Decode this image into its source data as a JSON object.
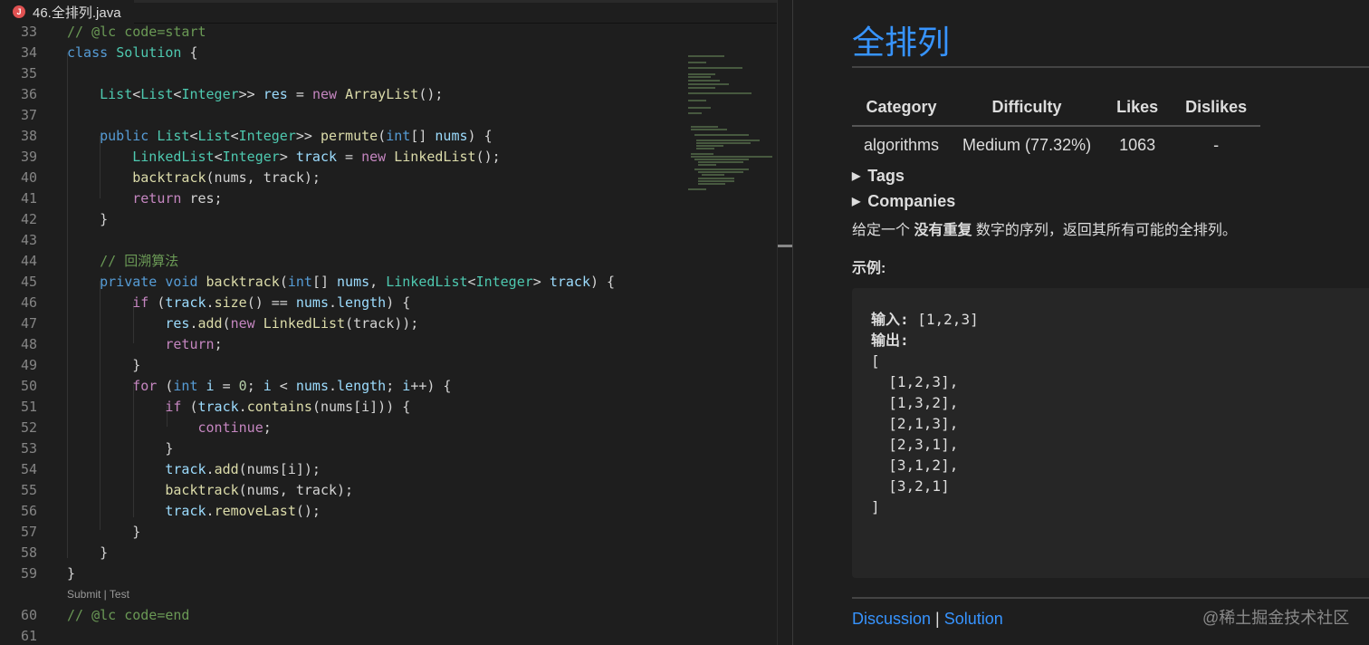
{
  "tab": {
    "icon": "J",
    "filename": "46.全排列.java"
  },
  "editor": {
    "lines": [
      {
        "n": "33",
        "t": [
          [
            "// @lc code=start",
            "cm"
          ]
        ]
      },
      {
        "n": "34",
        "t": [
          [
            "class ",
            "k"
          ],
          [
            "Solution",
            "t"
          ],
          [
            " {",
            "p"
          ]
        ]
      },
      {
        "n": "35",
        "t": []
      },
      {
        "n": "36",
        "t": [
          [
            "    ",
            "p"
          ],
          [
            "List",
            "t"
          ],
          [
            "<",
            "p"
          ],
          [
            "List",
            "t"
          ],
          [
            "<",
            "p"
          ],
          [
            "Integer",
            "t"
          ],
          [
            ">> ",
            "p"
          ],
          [
            "res",
            "v"
          ],
          [
            " = ",
            "p"
          ],
          [
            "new ",
            "c"
          ],
          [
            "ArrayList",
            "f"
          ],
          [
            "();",
            "p"
          ]
        ]
      },
      {
        "n": "37",
        "t": []
      },
      {
        "n": "38",
        "t": [
          [
            "    ",
            "p"
          ],
          [
            "public ",
            "k"
          ],
          [
            "List",
            "t"
          ],
          [
            "<",
            "p"
          ],
          [
            "List",
            "t"
          ],
          [
            "<",
            "p"
          ],
          [
            "Integer",
            "t"
          ],
          [
            ">> ",
            "p"
          ],
          [
            "permute",
            "f"
          ],
          [
            "(",
            "p"
          ],
          [
            "int",
            "k"
          ],
          [
            "[] ",
            "p"
          ],
          [
            "nums",
            "v"
          ],
          [
            ") {",
            "p"
          ]
        ]
      },
      {
        "n": "39",
        "t": [
          [
            "        ",
            "p"
          ],
          [
            "LinkedList",
            "t"
          ],
          [
            "<",
            "p"
          ],
          [
            "Integer",
            "t"
          ],
          [
            "> ",
            "p"
          ],
          [
            "track",
            "v"
          ],
          [
            " = ",
            "p"
          ],
          [
            "new ",
            "c"
          ],
          [
            "LinkedList",
            "f"
          ],
          [
            "();",
            "p"
          ]
        ]
      },
      {
        "n": "40",
        "t": [
          [
            "        ",
            "p"
          ],
          [
            "backtrack",
            "f"
          ],
          [
            "(nums, track);",
            "p"
          ]
        ]
      },
      {
        "n": "41",
        "t": [
          [
            "        ",
            "p"
          ],
          [
            "return ",
            "c"
          ],
          [
            "res;",
            "p"
          ]
        ]
      },
      {
        "n": "42",
        "t": [
          [
            "    }",
            "p"
          ]
        ]
      },
      {
        "n": "43",
        "t": []
      },
      {
        "n": "44",
        "t": [
          [
            "    ",
            "p"
          ],
          [
            "// 回溯算法",
            "cm"
          ]
        ]
      },
      {
        "n": "45",
        "t": [
          [
            "    ",
            "p"
          ],
          [
            "private ",
            "k"
          ],
          [
            "void ",
            "k"
          ],
          [
            "backtrack",
            "f"
          ],
          [
            "(",
            "p"
          ],
          [
            "int",
            "k"
          ],
          [
            "[] ",
            "p"
          ],
          [
            "nums",
            "v"
          ],
          [
            ", ",
            "p"
          ],
          [
            "LinkedList",
            "t"
          ],
          [
            "<",
            "p"
          ],
          [
            "Integer",
            "t"
          ],
          [
            "> ",
            "p"
          ],
          [
            "track",
            "v"
          ],
          [
            ") {",
            "p"
          ]
        ]
      },
      {
        "n": "46",
        "t": [
          [
            "        ",
            "p"
          ],
          [
            "if ",
            "c"
          ],
          [
            "(",
            "p"
          ],
          [
            "track",
            "v"
          ],
          [
            ".",
            "p"
          ],
          [
            "size",
            "f"
          ],
          [
            "() == ",
            "p"
          ],
          [
            "nums",
            "v"
          ],
          [
            ".",
            "p"
          ],
          [
            "length",
            "v"
          ],
          [
            ") {",
            "p"
          ]
        ]
      },
      {
        "n": "47",
        "t": [
          [
            "            ",
            "p"
          ],
          [
            "res",
            "v"
          ],
          [
            ".",
            "p"
          ],
          [
            "add",
            "f"
          ],
          [
            "(",
            "p"
          ],
          [
            "new ",
            "c"
          ],
          [
            "LinkedList",
            "f"
          ],
          [
            "(track));",
            "p"
          ]
        ]
      },
      {
        "n": "48",
        "t": [
          [
            "            ",
            "p"
          ],
          [
            "return",
            "c"
          ],
          [
            ";",
            "p"
          ]
        ]
      },
      {
        "n": "49",
        "t": [
          [
            "        }",
            "p"
          ]
        ]
      },
      {
        "n": "50",
        "t": [
          [
            "        ",
            "p"
          ],
          [
            "for ",
            "c"
          ],
          [
            "(",
            "p"
          ],
          [
            "int ",
            "k"
          ],
          [
            "i",
            "v"
          ],
          [
            " = ",
            "p"
          ],
          [
            "0",
            "n"
          ],
          [
            "; ",
            "p"
          ],
          [
            "i",
            "v"
          ],
          [
            " < ",
            "p"
          ],
          [
            "nums",
            "v"
          ],
          [
            ".",
            "p"
          ],
          [
            "length",
            "v"
          ],
          [
            "; ",
            "p"
          ],
          [
            "i",
            "v"
          ],
          [
            "++) {",
            "p"
          ]
        ]
      },
      {
        "n": "51",
        "t": [
          [
            "            ",
            "p"
          ],
          [
            "if ",
            "c"
          ],
          [
            "(",
            "p"
          ],
          [
            "track",
            "v"
          ],
          [
            ".",
            "p"
          ],
          [
            "contains",
            "f"
          ],
          [
            "(nums[i])) {",
            "p"
          ]
        ]
      },
      {
        "n": "52",
        "t": [
          [
            "                ",
            "p"
          ],
          [
            "continue",
            "c"
          ],
          [
            ";",
            "p"
          ]
        ]
      },
      {
        "n": "53",
        "t": [
          [
            "            }",
            "p"
          ]
        ]
      },
      {
        "n": "54",
        "t": [
          [
            "            ",
            "p"
          ],
          [
            "track",
            "v"
          ],
          [
            ".",
            "p"
          ],
          [
            "add",
            "f"
          ],
          [
            "(nums[i]);",
            "p"
          ]
        ]
      },
      {
        "n": "55",
        "t": [
          [
            "            ",
            "p"
          ],
          [
            "backtrack",
            "f"
          ],
          [
            "(nums, track);",
            "p"
          ]
        ]
      },
      {
        "n": "56",
        "t": [
          [
            "            ",
            "p"
          ],
          [
            "track",
            "v"
          ],
          [
            ".",
            "p"
          ],
          [
            "removeLast",
            "f"
          ],
          [
            "();",
            "p"
          ]
        ]
      },
      {
        "n": "57",
        "t": [
          [
            "        }",
            "p"
          ]
        ]
      },
      {
        "n": "58",
        "t": [
          [
            "    }",
            "p"
          ]
        ]
      },
      {
        "n": "59",
        "t": [
          [
            "}",
            "p"
          ]
        ]
      },
      {
        "lens": "Submit | Test"
      },
      {
        "n": "60",
        "t": [
          [
            "// @lc code=end",
            "cm"
          ]
        ]
      },
      {
        "n": "61",
        "t": []
      }
    ]
  },
  "preview": {
    "title": "全排列",
    "table": {
      "headers": [
        "Category",
        "Difficulty",
        "Likes",
        "Dislikes"
      ],
      "row": [
        "algorithms",
        "Medium (77.32%)",
        "1063",
        "-"
      ]
    },
    "tags": "Tags",
    "companies": "Companies",
    "desc_pre": "给定一个 ",
    "desc_bold": "没有重复",
    "desc_post": " 数字的序列，返回其所有可能的全排列。",
    "example_label": "示例:",
    "example": {
      "input_label": "输入:",
      "input": " [1,2,3]",
      "output_label": "输出:",
      "output": "[\n  [1,2,3],\n  [1,3,2],\n  [2,1,3],\n  [2,3,1],\n  [3,1,2],\n  [3,2,1]\n]"
    },
    "discussion": "Discussion",
    "sep": " | ",
    "solution": "Solution"
  },
  "watermark": "@稀土掘金技术社区",
  "colors": {
    "accent": "#3794ff",
    "background": "#1e1e1e"
  }
}
